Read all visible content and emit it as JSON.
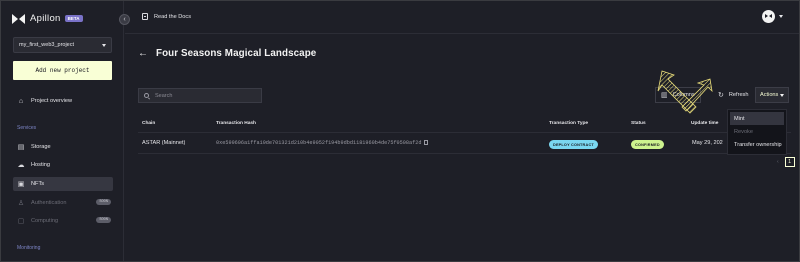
{
  "app": {
    "name": "Apillon",
    "badge": "BETA"
  },
  "sidebar": {
    "project": "my_first_web3_project",
    "add_project": "Add new project",
    "overview": "Project overview",
    "services_label": "Services",
    "items": [
      {
        "label": "Storage",
        "icon": "database-icon",
        "state": "normal"
      },
      {
        "label": "Hosting",
        "icon": "cloud-icon",
        "state": "normal"
      },
      {
        "label": "NFTs",
        "icon": "image-stack-icon",
        "state": "active"
      },
      {
        "label": "Authentication",
        "icon": "user-icon",
        "state": "disabled",
        "badge": "SOON"
      },
      {
        "label": "Computing",
        "icon": "chip-icon",
        "state": "disabled",
        "badge": "SOON"
      }
    ],
    "monitoring_label": "Monitoring"
  },
  "topbar": {
    "docs": "Read the Docs"
  },
  "page": {
    "title": "Four Seasons Magical Landscape"
  },
  "search": {
    "placeholder": "Search"
  },
  "toolbar": {
    "columns_label": "Columns",
    "refresh": "Refresh",
    "actions": "Actions"
  },
  "actions_menu": [
    {
      "label": "Mint",
      "state": "hover"
    },
    {
      "label": "Revoke",
      "state": "disabled"
    },
    {
      "label": "Transfer ownership",
      "state": "normal"
    }
  ],
  "table": {
    "headers": [
      "Chain",
      "Transaction Hash",
      "Transaction Type",
      "Status",
      "Update time"
    ],
    "rows": [
      {
        "chain": "ASTAR (Mainnet)",
        "hash": "0xe599606a1ffa19de701321d210b4e9052f194b9dbd1181960b4de75f0508af2d",
        "type": "DEPLOY CONTRACT",
        "status": "CONFIRMED",
        "time": "May 29, 202"
      }
    ]
  },
  "pagination": {
    "current": "1"
  },
  "colors": {
    "accent": "#f9ffd6",
    "deploy_pill": "#7ad7f0",
    "confirmed_pill": "#cdf28e",
    "services_label": "#7e86c8"
  }
}
